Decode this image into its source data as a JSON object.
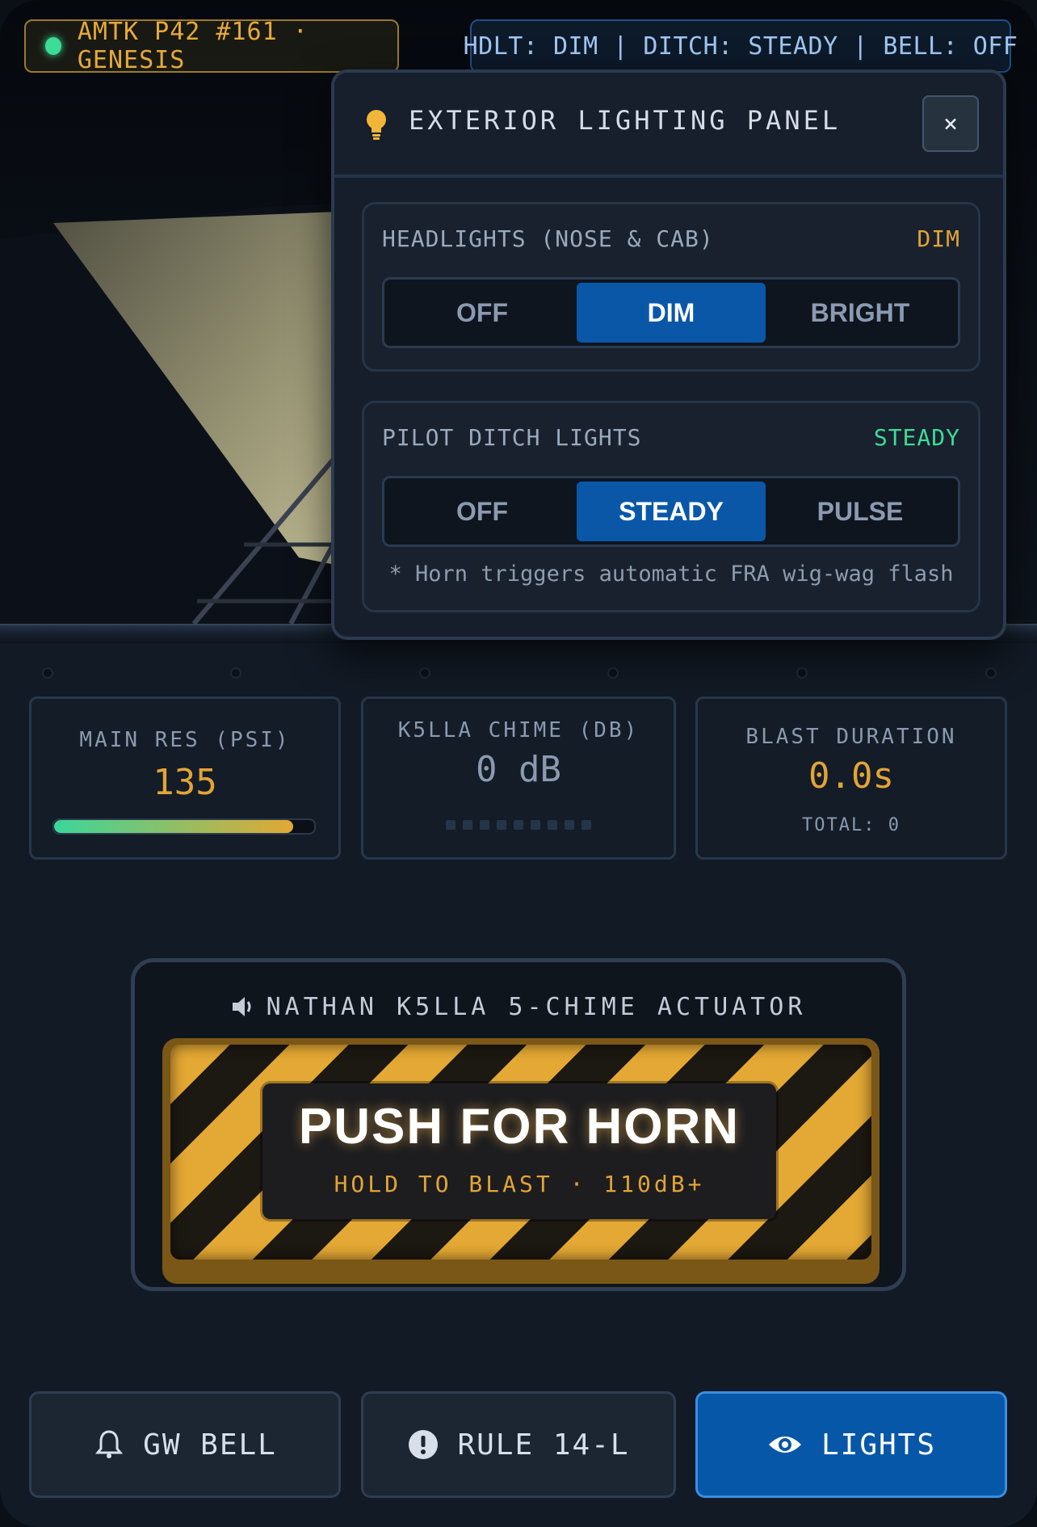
{
  "header": {
    "loco_label": "AMTK P42 #161 · GENESIS",
    "status_line": "HDLT: DIM | DITCH: STEADY | BELL: OFF"
  },
  "modal": {
    "title": "EXTERIOR LIGHTING PANEL",
    "close_label": "×",
    "headlights": {
      "label": "HEADLIGHTS (NOSE & CAB)",
      "value": "DIM",
      "value_color": "#e3a436",
      "options": [
        "OFF",
        "DIM",
        "BRIGHT"
      ],
      "selected": "DIM"
    },
    "ditch": {
      "label": "PILOT DITCH LIGHTS",
      "value": "STEADY",
      "value_color": "#3ddc97",
      "options": [
        "OFF",
        "STEADY",
        "PULSE"
      ],
      "selected": "STEADY",
      "note": "* Horn triggers automatic FRA wig-wag flash"
    }
  },
  "gauges": {
    "main_res": {
      "label": "MAIN RES (PSI)",
      "value": "135",
      "fill_fraction": 0.92
    },
    "chime": {
      "label": "K5LLA CHIME (DB)",
      "value": "0 dB",
      "led_count": 9,
      "leds_lit": 0
    },
    "blast": {
      "label": "BLAST DURATION",
      "value": "0.0s",
      "total": "TOTAL: 0"
    }
  },
  "horn": {
    "caption": "NATHAN K5LLA 5-CHIME ACTUATOR",
    "title": "PUSH FOR HORN",
    "subtitle": "HOLD TO BLAST · 110dB+"
  },
  "bottom": {
    "bell": {
      "label": "GW BELL",
      "icon": "bell-icon"
    },
    "rule": {
      "label": "RULE 14-L",
      "icon": "alert-icon"
    },
    "lights": {
      "label": "LIGHTS",
      "icon": "eye-icon",
      "active": true
    }
  },
  "colors": {
    "accent_amber": "#e3a436",
    "accent_green": "#3ddc97",
    "accent_blue": "#0657a8"
  }
}
